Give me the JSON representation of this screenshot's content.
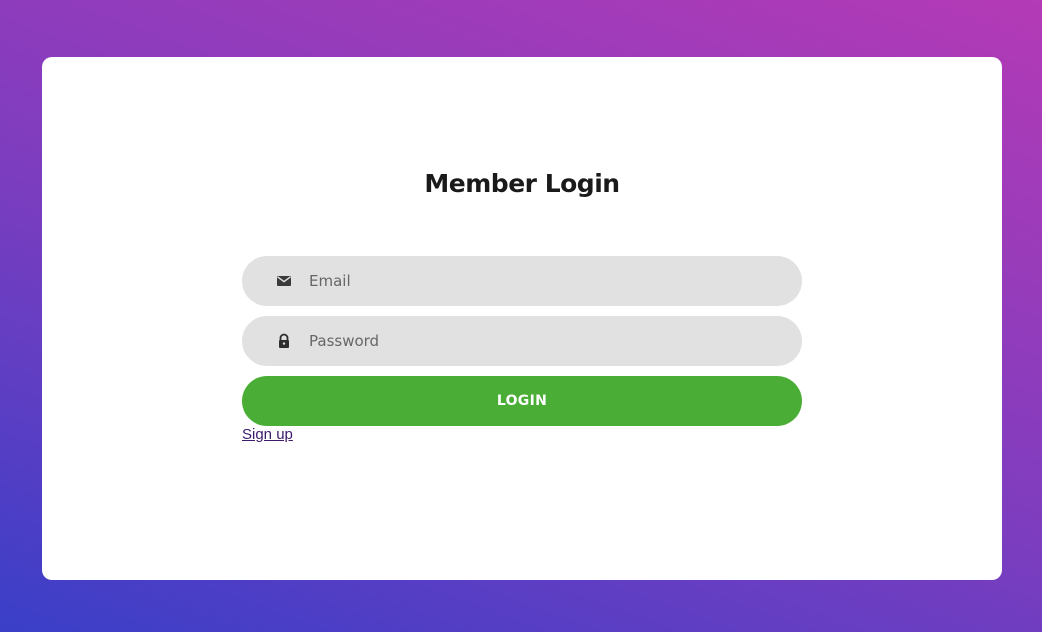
{
  "login_form": {
    "title": "Member Login",
    "email": {
      "placeholder": "Email",
      "value": "",
      "icon": "envelope-icon"
    },
    "password": {
      "placeholder": "Password",
      "value": "",
      "icon": "lock-icon"
    },
    "submit_label": "LOGIN",
    "signup_link": "Sign up"
  },
  "colors": {
    "background_gradient_start": "#3a3fc8",
    "background_gradient_end": "#b43ab6",
    "card": "#ffffff",
    "field_bg": "#e1e1e1",
    "button": "#4aae36",
    "link": "#3d1a6b"
  }
}
